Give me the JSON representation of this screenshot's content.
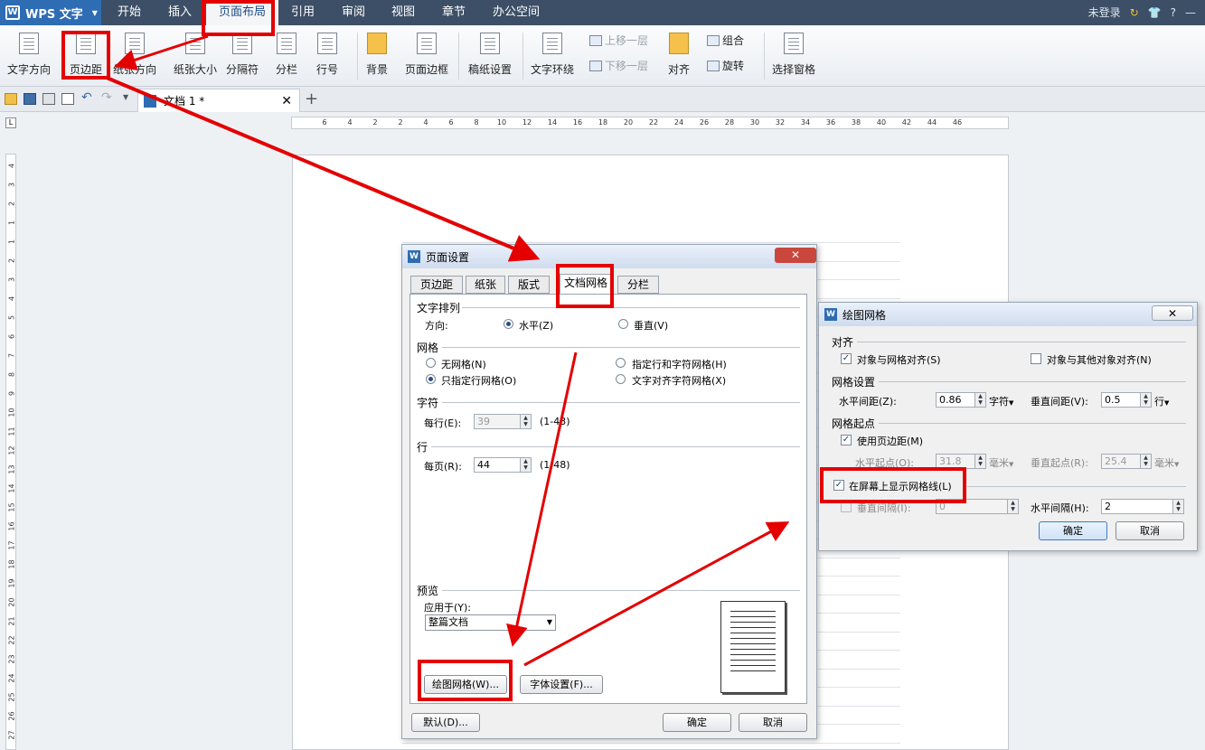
{
  "app": {
    "logo_text": "WPS 文字"
  },
  "menu": {
    "items": [
      "开始",
      "插入",
      "页面布局",
      "引用",
      "审阅",
      "视图",
      "章节",
      "办公空间"
    ],
    "active": "页面布局"
  },
  "menu_right": {
    "login": "未登录",
    "help": "?"
  },
  "ribbon": {
    "text_direction": "文字方向",
    "margins": "页边距",
    "orientation": "纸张方向",
    "size": "纸张大小",
    "breaks": "分隔符",
    "columns": "分栏",
    "line_numbers": "行号",
    "background": "背景",
    "page_border": "页面边框",
    "manuscript": "稿纸设置",
    "wrap_text": "文字环绕",
    "bring_forward": "上移一层",
    "send_backward": "下移一层",
    "align": "对齐",
    "group": "组合",
    "rotate": "旋转",
    "selection_pane": "选择窗格"
  },
  "doc_tab": {
    "name": "文档 1 *"
  },
  "ruler": {
    "h_ticks": [
      "6",
      "4",
      "2",
      "2",
      "4",
      "6",
      "8",
      "10",
      "12",
      "14",
      "16",
      "18",
      "20",
      "22",
      "24",
      "26",
      "28",
      "30",
      "32",
      "34",
      "36",
      "38",
      "40",
      "42",
      "44",
      "46"
    ],
    "v_ticks": [
      "4",
      "3",
      "2",
      "1",
      "1",
      "2",
      "3",
      "4",
      "5",
      "6",
      "7",
      "8",
      "9",
      "10",
      "11",
      "12",
      "13",
      "14",
      "15",
      "16",
      "17",
      "18",
      "19",
      "20",
      "21",
      "22",
      "23",
      "24",
      "25",
      "26",
      "27"
    ]
  },
  "page_setup": {
    "title": "页面设置",
    "tabs": [
      "页边距",
      "纸张",
      "版式",
      "文档网格",
      "分栏"
    ],
    "active_tab": "文档网格",
    "text_layout": {
      "heading": "文字排列",
      "direction_label": "方向:",
      "horizontal": "水平(Z)",
      "vertical": "垂直(V)",
      "selected": "水平(Z)"
    },
    "grid": {
      "heading": "网格",
      "no_grid": "无网格(N)",
      "lines_only": "只指定行网格(O)",
      "lines_and_chars": "指定行和字符网格(H)",
      "snap_chars": "文字对齐字符网格(X)",
      "selected": "只指定行网格(O)"
    },
    "chars": {
      "heading": "字符",
      "per_line_label": "每行(E):",
      "per_line_value": "39",
      "per_line_range": "(1-43)"
    },
    "lines": {
      "heading": "行",
      "per_page_label": "每页(R):",
      "per_page_value": "44",
      "per_page_range": "(1-48)"
    },
    "preview": {
      "heading": "预览",
      "apply_label": "应用于(Y):",
      "apply_value": "整篇文档"
    },
    "buttons": {
      "draw_grid": "绘图网格(W)...",
      "font_settings": "字体设置(F)...",
      "default": "默认(D)...",
      "ok": "确定",
      "cancel": "取消"
    }
  },
  "draw_grid": {
    "title": "绘图网格",
    "align": {
      "heading": "对齐",
      "snap_grid": "对象与网格对齐(S)",
      "snap_grid_checked": true,
      "snap_objects": "对象与其他对象对齐(N)",
      "snap_objects_checked": false
    },
    "settings": {
      "heading": "网格设置",
      "h_spacing_label": "水平间距(Z):",
      "h_spacing_value": "0.86",
      "h_spacing_unit": "字符",
      "v_spacing_label": "垂直间距(V):",
      "v_spacing_value": "0.5",
      "v_spacing_unit": "行"
    },
    "origin": {
      "heading": "网格起点",
      "use_margins": "使用页边距(M)",
      "use_margins_checked": true,
      "h_origin_label": "水平起点(O):",
      "h_origin_value": "31.8",
      "h_origin_unit": "毫米",
      "v_origin_label": "垂直起点(R):",
      "v_origin_value": "25.4",
      "v_origin_unit": "毫米"
    },
    "display": {
      "show_grid": "在屏幕上显示网格线(L)",
      "show_grid_checked": true,
      "v_every_label": "垂直间隔(I):",
      "v_every_value": "0",
      "h_every_label": "水平间隔(H):",
      "h_every_value": "2"
    },
    "buttons": {
      "ok": "确定",
      "cancel": "取消"
    }
  },
  "colors": {
    "highlight": "#e40000",
    "menubar": "#3c4f66",
    "wps_blue": "#2e6cb3"
  }
}
